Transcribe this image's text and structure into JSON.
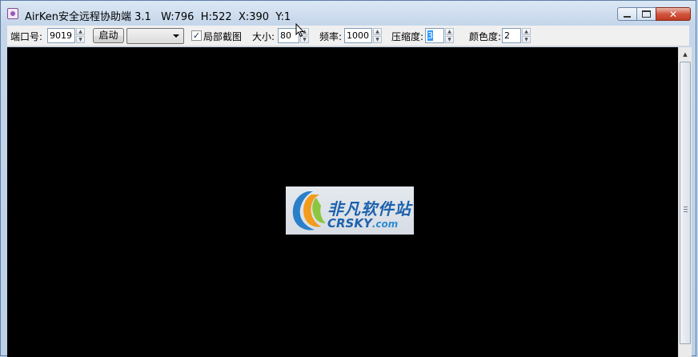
{
  "window": {
    "title": "AirKen安全远程协助端 3.1   W:796  H:522  X:390  Y:1",
    "controls": {
      "minimize": "minimize",
      "maximize": "maximize",
      "close": "close"
    }
  },
  "toolbar": {
    "port_label": "端口号:",
    "port_value": "9019",
    "start_label": "启动",
    "combo_value": "",
    "partial_capture_label": "局部截图",
    "partial_capture_checked": true,
    "size_label": "大小:",
    "size_value": "80",
    "frequency_label": "频率:",
    "frequency_value": "1000",
    "compression_label": "压缩度:",
    "compression_value": "3",
    "color_label": "颜色度:",
    "color_value": "2"
  },
  "screen": {
    "watermark_cn": "非凡软件站",
    "watermark_en": "CRSKY",
    "watermark_dotcom": ".com"
  },
  "icons": [
    "app-icon",
    "minimize-icon",
    "maximize-icon",
    "close-icon",
    "checkmark-icon",
    "spin-up-icon",
    "spin-down-icon",
    "dropdown-arrow-icon",
    "scroll-up-icon",
    "scroll-down-icon",
    "mouse-cursor-icon"
  ]
}
